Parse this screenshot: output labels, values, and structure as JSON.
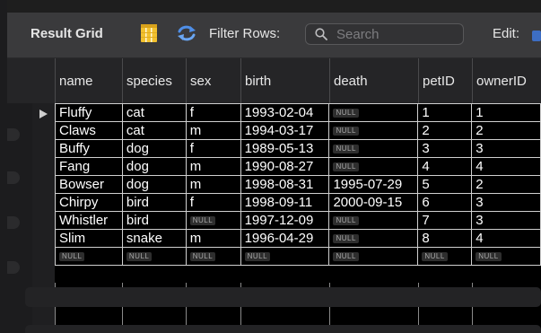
{
  "toolbar": {
    "title": "Result Grid",
    "filter_label": "Filter Rows:",
    "search_placeholder": "Search",
    "edit_label": "Edit:"
  },
  "grid": {
    "columns": [
      "name",
      "species",
      "sex",
      "birth",
      "death",
      "petID",
      "ownerID"
    ],
    "null_label": "NULL",
    "rows": [
      [
        "Fluffy",
        "cat",
        "f",
        "1993-02-04",
        null,
        "1",
        "1"
      ],
      [
        "Claws",
        "cat",
        "m",
        "1994-03-17",
        null,
        "2",
        "2"
      ],
      [
        "Buffy",
        "dog",
        "f",
        "1989-05-13",
        null,
        "3",
        "3"
      ],
      [
        "Fang",
        "dog",
        "m",
        "1990-08-27",
        null,
        "4",
        "4"
      ],
      [
        "Bowser",
        "dog",
        "m",
        "1998-08-31",
        "1995-07-29",
        "5",
        "2"
      ],
      [
        "Chirpy",
        "bird",
        "f",
        "1998-09-11",
        "2000-09-15",
        "6",
        "3"
      ],
      [
        "Whistler",
        "bird",
        null,
        "1997-12-09",
        null,
        "7",
        "3"
      ],
      [
        "Slim",
        "snake",
        "m",
        "1996-04-29",
        null,
        "8",
        "4"
      ],
      [
        null,
        null,
        null,
        null,
        null,
        null,
        null
      ]
    ]
  },
  "icons": {
    "grid": "result-grid-columns-icon",
    "refresh": "refresh-arrows-icon",
    "search": "magnifier-icon",
    "edit": "edit-mode-icon",
    "row_marker": "current-row-triangle-icon"
  },
  "colors": {
    "toolbar_bg": "#3a3a3c",
    "grid_bg": "#000000",
    "cell_border": "#d0d0d0",
    "grid_icon_yellow": "#f2c12e",
    "refresh_icon_blue": "#4f8fe8"
  }
}
